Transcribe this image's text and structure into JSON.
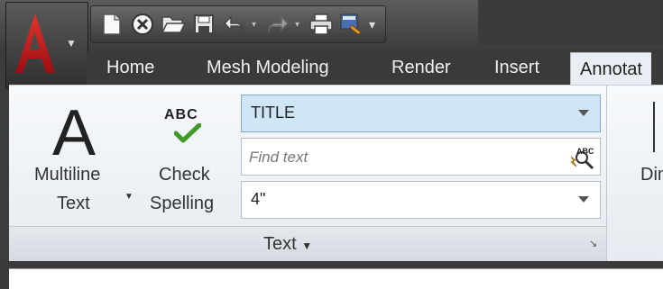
{
  "app": {
    "logo_letter": "A"
  },
  "quick_access": [
    {
      "name": "new-icon"
    },
    {
      "name": "close-icon"
    },
    {
      "name": "open-icon"
    },
    {
      "name": "save-icon"
    },
    {
      "name": "undo-icon"
    },
    {
      "name": "redo-icon"
    },
    {
      "name": "print-icon"
    },
    {
      "name": "workspace-icon"
    }
  ],
  "tabs": [
    {
      "label": "Home",
      "active": false
    },
    {
      "label": "Mesh Modeling",
      "active": false
    },
    {
      "label": "Render",
      "active": false
    },
    {
      "label": "Insert",
      "active": false
    },
    {
      "label": "Annotat",
      "active": true
    }
  ],
  "ribbon": {
    "multiline": {
      "line1": "Multiline",
      "line2": "Text"
    },
    "check_spelling": {
      "line1": "Check",
      "line2": "Spelling",
      "glyph": "ABC"
    },
    "style_combo": {
      "value": "TITLE"
    },
    "find_text": {
      "placeholder": "Find text"
    },
    "height_combo": {
      "value": "4\""
    },
    "panel_label": "Text",
    "next_panel_label": "Dim"
  },
  "colors": {
    "accent_red": "#c8161d",
    "check_green": "#3f9a2a",
    "combo_highlight": "#cfe6f7"
  }
}
